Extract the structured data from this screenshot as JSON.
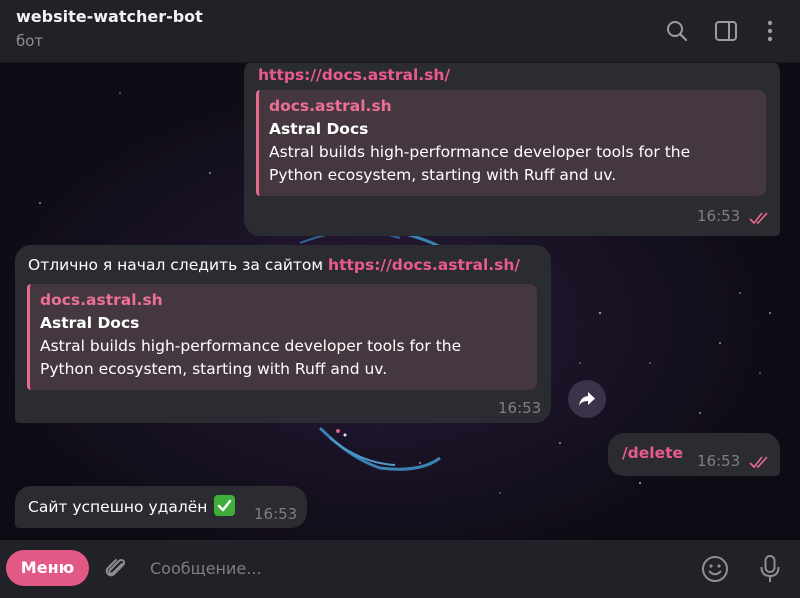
{
  "header": {
    "title": "website-watcher-bot",
    "subtitle": "бот",
    "icons": [
      "search-icon",
      "sidebar-panel-icon",
      "more-vertical-icon"
    ]
  },
  "messages": {
    "m1": {
      "direction": "outgoing",
      "link": "https://docs.astral.sh/",
      "preview": {
        "site": "docs.astral.sh",
        "title": "Astral Docs",
        "description_line1": "Astral builds high-performance developer tools for the",
        "description_line2": "Python ecosystem, starting with Ruff and uv."
      },
      "time": "16:53",
      "status": "read"
    },
    "m2": {
      "direction": "incoming",
      "text": "Отлично я начал следить за сайтом ",
      "link": "https://docs.astral.sh/",
      "preview": {
        "site": "docs.astral.sh",
        "title": "Astral Docs",
        "description_line1": "Astral builds high-performance developer tools for the",
        "description_line2": "Python ecosystem, starting with Ruff and uv."
      },
      "time": "16:53"
    },
    "m3": {
      "direction": "outgoing",
      "command": "/delete",
      "time": "16:53",
      "status": "read"
    },
    "m4": {
      "direction": "incoming",
      "text": "Сайт успешно удалён",
      "emoji": "check-mark-button-emoji",
      "time": "16:53"
    }
  },
  "composer": {
    "menu_label": "Меню",
    "placeholder": "Сообщение...",
    "value": ""
  },
  "colors": {
    "accent": "#e35985",
    "link": "#eb5a8c",
    "bubble": "#2b2c31",
    "preview_bg": "#45373f",
    "header_bg": "#212227"
  }
}
